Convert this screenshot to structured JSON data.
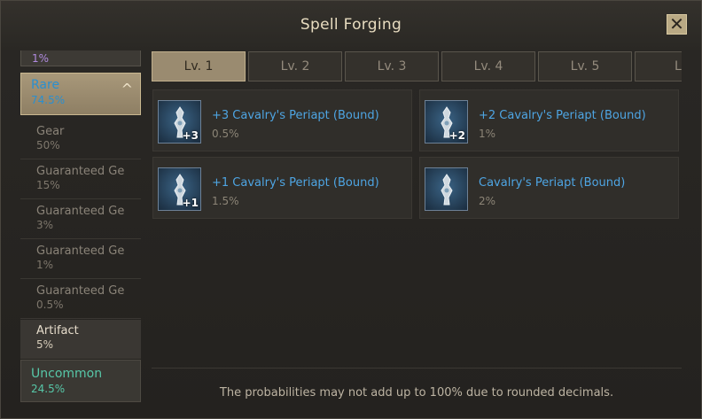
{
  "window": {
    "title": "Spell Forging",
    "close_glyph": "✕"
  },
  "left_panel": {
    "top_category_percent": "1%",
    "rare": {
      "name": "Rare",
      "percent": "74.5%",
      "chevron": "^"
    },
    "rare_items": [
      {
        "name": "Gear",
        "percent": "50%"
      },
      {
        "name": "Guaranteed Ge",
        "percent": "15%"
      },
      {
        "name": "Guaranteed Ge",
        "percent": "3%"
      },
      {
        "name": "Guaranteed Ge",
        "percent": "1%"
      },
      {
        "name": "Guaranteed Ge",
        "percent": "0.5%"
      },
      {
        "name": "Artifact",
        "percent": "5%"
      }
    ],
    "uncommon": {
      "name": "Uncommon",
      "percent": "24.5%"
    }
  },
  "tabs": [
    "Lv. 1",
    "Lv. 2",
    "Lv. 3",
    "Lv. 4",
    "Lv. 5",
    "Lv"
  ],
  "items": [
    {
      "name": "+3 Cavalry's Periapt (Bound)",
      "probability": "0.5%",
      "badge": "+3",
      "icon": "periapt-icon"
    },
    {
      "name": "+2 Cavalry's Periapt (Bound)",
      "probability": "1%",
      "badge": "+2",
      "icon": "periapt-icon"
    },
    {
      "name": "+1 Cavalry's Periapt (Bound)",
      "probability": "1.5%",
      "badge": "+1",
      "icon": "periapt-icon"
    },
    {
      "name": "Cavalry's Periapt (Bound)",
      "probability": "2%",
      "badge": "",
      "icon": "periapt-icon"
    }
  ],
  "footer": {
    "notice": "The probabilities may not add up to 100% due to rounded decimals."
  },
  "colors": {
    "rare": "#2a8fd0",
    "uncommon": "#57c7a8",
    "epic": "#b18be0",
    "item_name": "#4ea5e3"
  }
}
